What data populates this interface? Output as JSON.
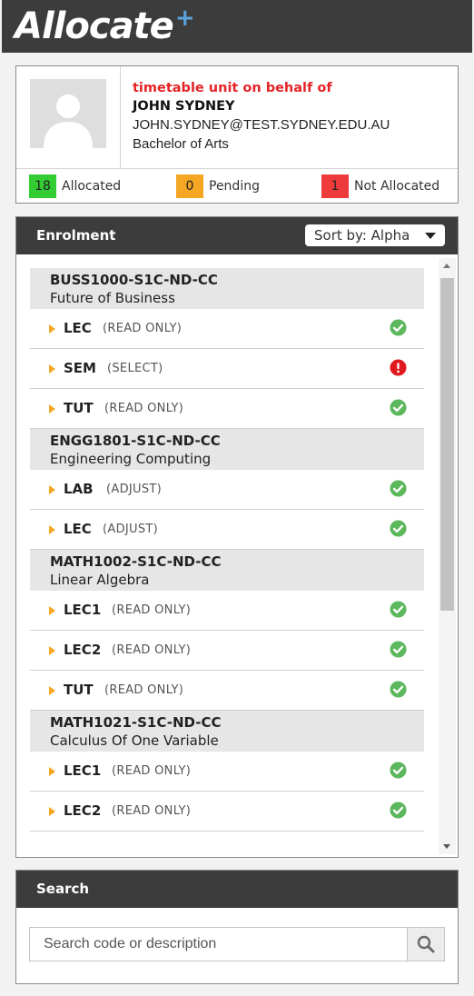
{
  "app": {
    "logo_text": "Allocate",
    "logo_plus": "+"
  },
  "profile": {
    "behalf_text": "timetable unit on behalf of",
    "name": "JOHN SYDNEY",
    "email": "JOHN.SYDNEY@TEST.SYDNEY.EDU.AU",
    "degree": "Bachelor of Arts",
    "avatar_icon": "user-silhouette-icon",
    "stats": [
      {
        "count": "18",
        "label": "Allocated",
        "color": "#33cc33"
      },
      {
        "count": "0",
        "label": "Pending",
        "color": "#f5a623"
      },
      {
        "count": "1",
        "label": "Not Allocated",
        "color": "#ee3a3a"
      }
    ]
  },
  "enrolment": {
    "title": "Enrolment",
    "sort_label": "Sort by: Alpha",
    "courses": [
      {
        "code": "BUSS1000-S1C-ND-CC",
        "name": "Future of Business",
        "units": [
          {
            "type": "LEC",
            "mode": "(READ ONLY)",
            "status": "ok"
          },
          {
            "type": "SEM",
            "mode": "(SELECT)",
            "status": "error"
          },
          {
            "type": "TUT",
            "mode": "(READ ONLY)",
            "status": "ok"
          }
        ]
      },
      {
        "code": "ENGG1801-S1C-ND-CC",
        "name": "Engineering Computing",
        "units": [
          {
            "type": "LAB",
            "mode": "(ADJUST)",
            "status": "ok"
          },
          {
            "type": "LEC",
            "mode": "(ADJUST)",
            "status": "ok"
          }
        ]
      },
      {
        "code": "MATH1002-S1C-ND-CC",
        "name": "Linear Algebra",
        "units": [
          {
            "type": "LEC1",
            "mode": "(READ ONLY)",
            "status": "ok"
          },
          {
            "type": "LEC2",
            "mode": "(READ ONLY)",
            "status": "ok"
          },
          {
            "type": "TUT",
            "mode": "(READ ONLY)",
            "status": "ok"
          }
        ]
      },
      {
        "code": "MATH1021-S1C-ND-CC",
        "name": "Calculus Of One Variable",
        "units": [
          {
            "type": "LEC1",
            "mode": "(READ ONLY)",
            "status": "ok"
          },
          {
            "type": "LEC2",
            "mode": "(READ ONLY)",
            "status": "ok"
          }
        ]
      }
    ],
    "status_colors": {
      "ok": "#5cb85c",
      "error": "#e0191f"
    }
  },
  "search": {
    "title": "Search",
    "placeholder": "Search code or description",
    "value": "",
    "button_icon": "magnifier-icon"
  }
}
